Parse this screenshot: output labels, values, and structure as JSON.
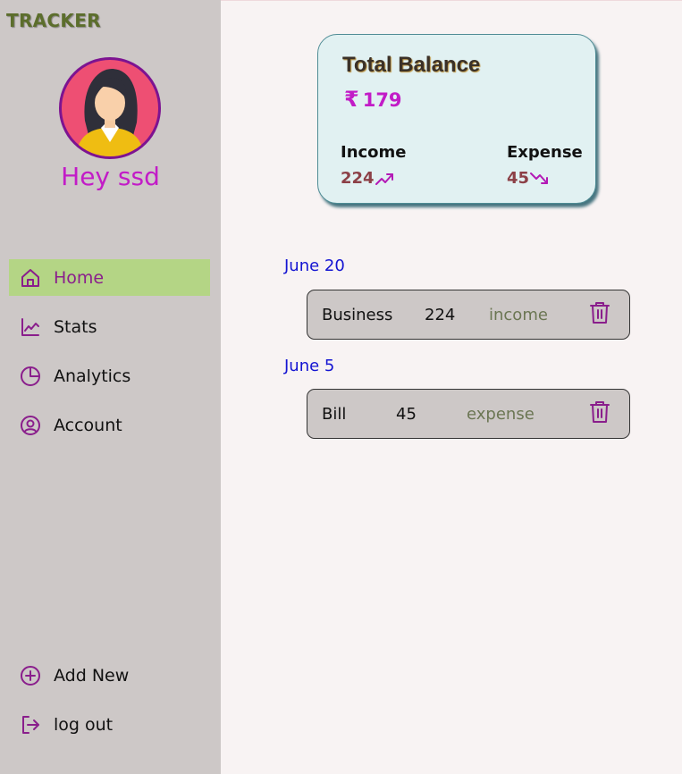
{
  "sidebar": {
    "brand": "TRACKER",
    "greeting": "Hey ssd",
    "nav": [
      {
        "label": "Home",
        "icon": "home-icon",
        "active": true
      },
      {
        "label": "Stats",
        "icon": "line-chart-icon"
      },
      {
        "label": "Analytics",
        "icon": "pie-chart-icon"
      },
      {
        "label": "Account",
        "icon": "user-circle-icon"
      }
    ],
    "bottom_nav": [
      {
        "label": "Add New",
        "icon": "plus-circle-icon"
      },
      {
        "label": "log out",
        "icon": "logout-icon"
      }
    ]
  },
  "balance": {
    "title": "Total Balance",
    "currency": "₹",
    "total": "179",
    "income_label": "Income",
    "income_value": "224",
    "expense_label": "Expense",
    "expense_value": "45"
  },
  "transactions": [
    {
      "date": "June 20",
      "name": "Business",
      "amount": "224",
      "type": "income"
    },
    {
      "date": "June 5",
      "name": "Bill",
      "amount": "45",
      "type": "expense"
    }
  ],
  "colors": {
    "sidebar_bg": "#cdc8c7",
    "active_nav_bg": "#b4d585",
    "accent_purple": "#8a1e8c",
    "greeting": "#c21cc7",
    "date_blue": "#1414d2",
    "card_bg": "#e1f1f2"
  }
}
